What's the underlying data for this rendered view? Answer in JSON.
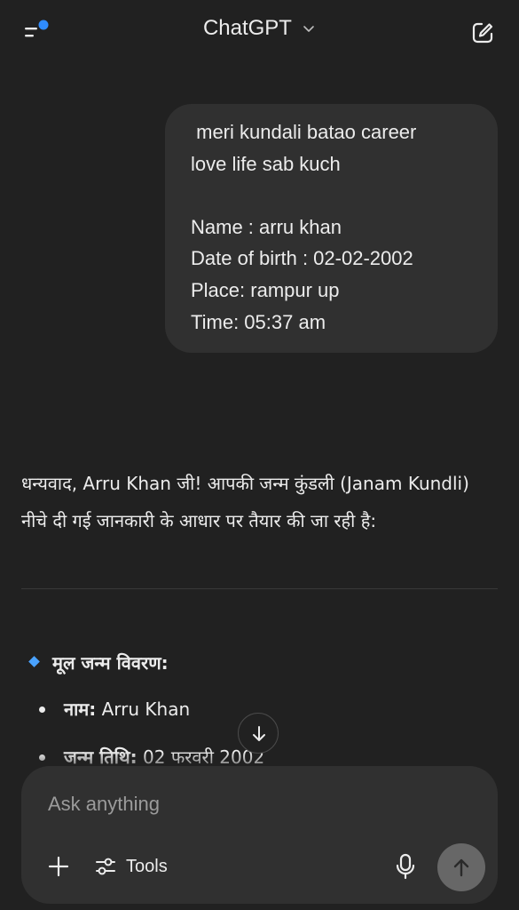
{
  "header": {
    "title": "ChatGPT",
    "menu_icon": "sidebar-menu-icon",
    "notification_dot_color": "#2f8cff",
    "new_chat_icon": "edit-icon"
  },
  "conversation": {
    "user_message": " meri kundali batao career\nlove life sab kuch\n\nName : arru khan\nDate of birth : 02-02-2002\nPlace: rampur up\nTime: 05:37 am",
    "assistant_intro": "धन्यवाद, Arru Khan जी! आपकी जन्म कुंडली (Janam Kundli) नीचे दी गई जानकारी के आधार पर तैयार की जा रही है:",
    "section_title": "मूल जन्म विवरण:",
    "details": [
      {
        "label": "नाम:",
        "value": " Arru Khan"
      },
      {
        "label": "जन्म तिथि:",
        "value": " 02 फरवरी 2002"
      }
    ]
  },
  "composer": {
    "placeholder": "Ask anything",
    "tools_label": "Tools",
    "accent_send_color": "#676767"
  }
}
